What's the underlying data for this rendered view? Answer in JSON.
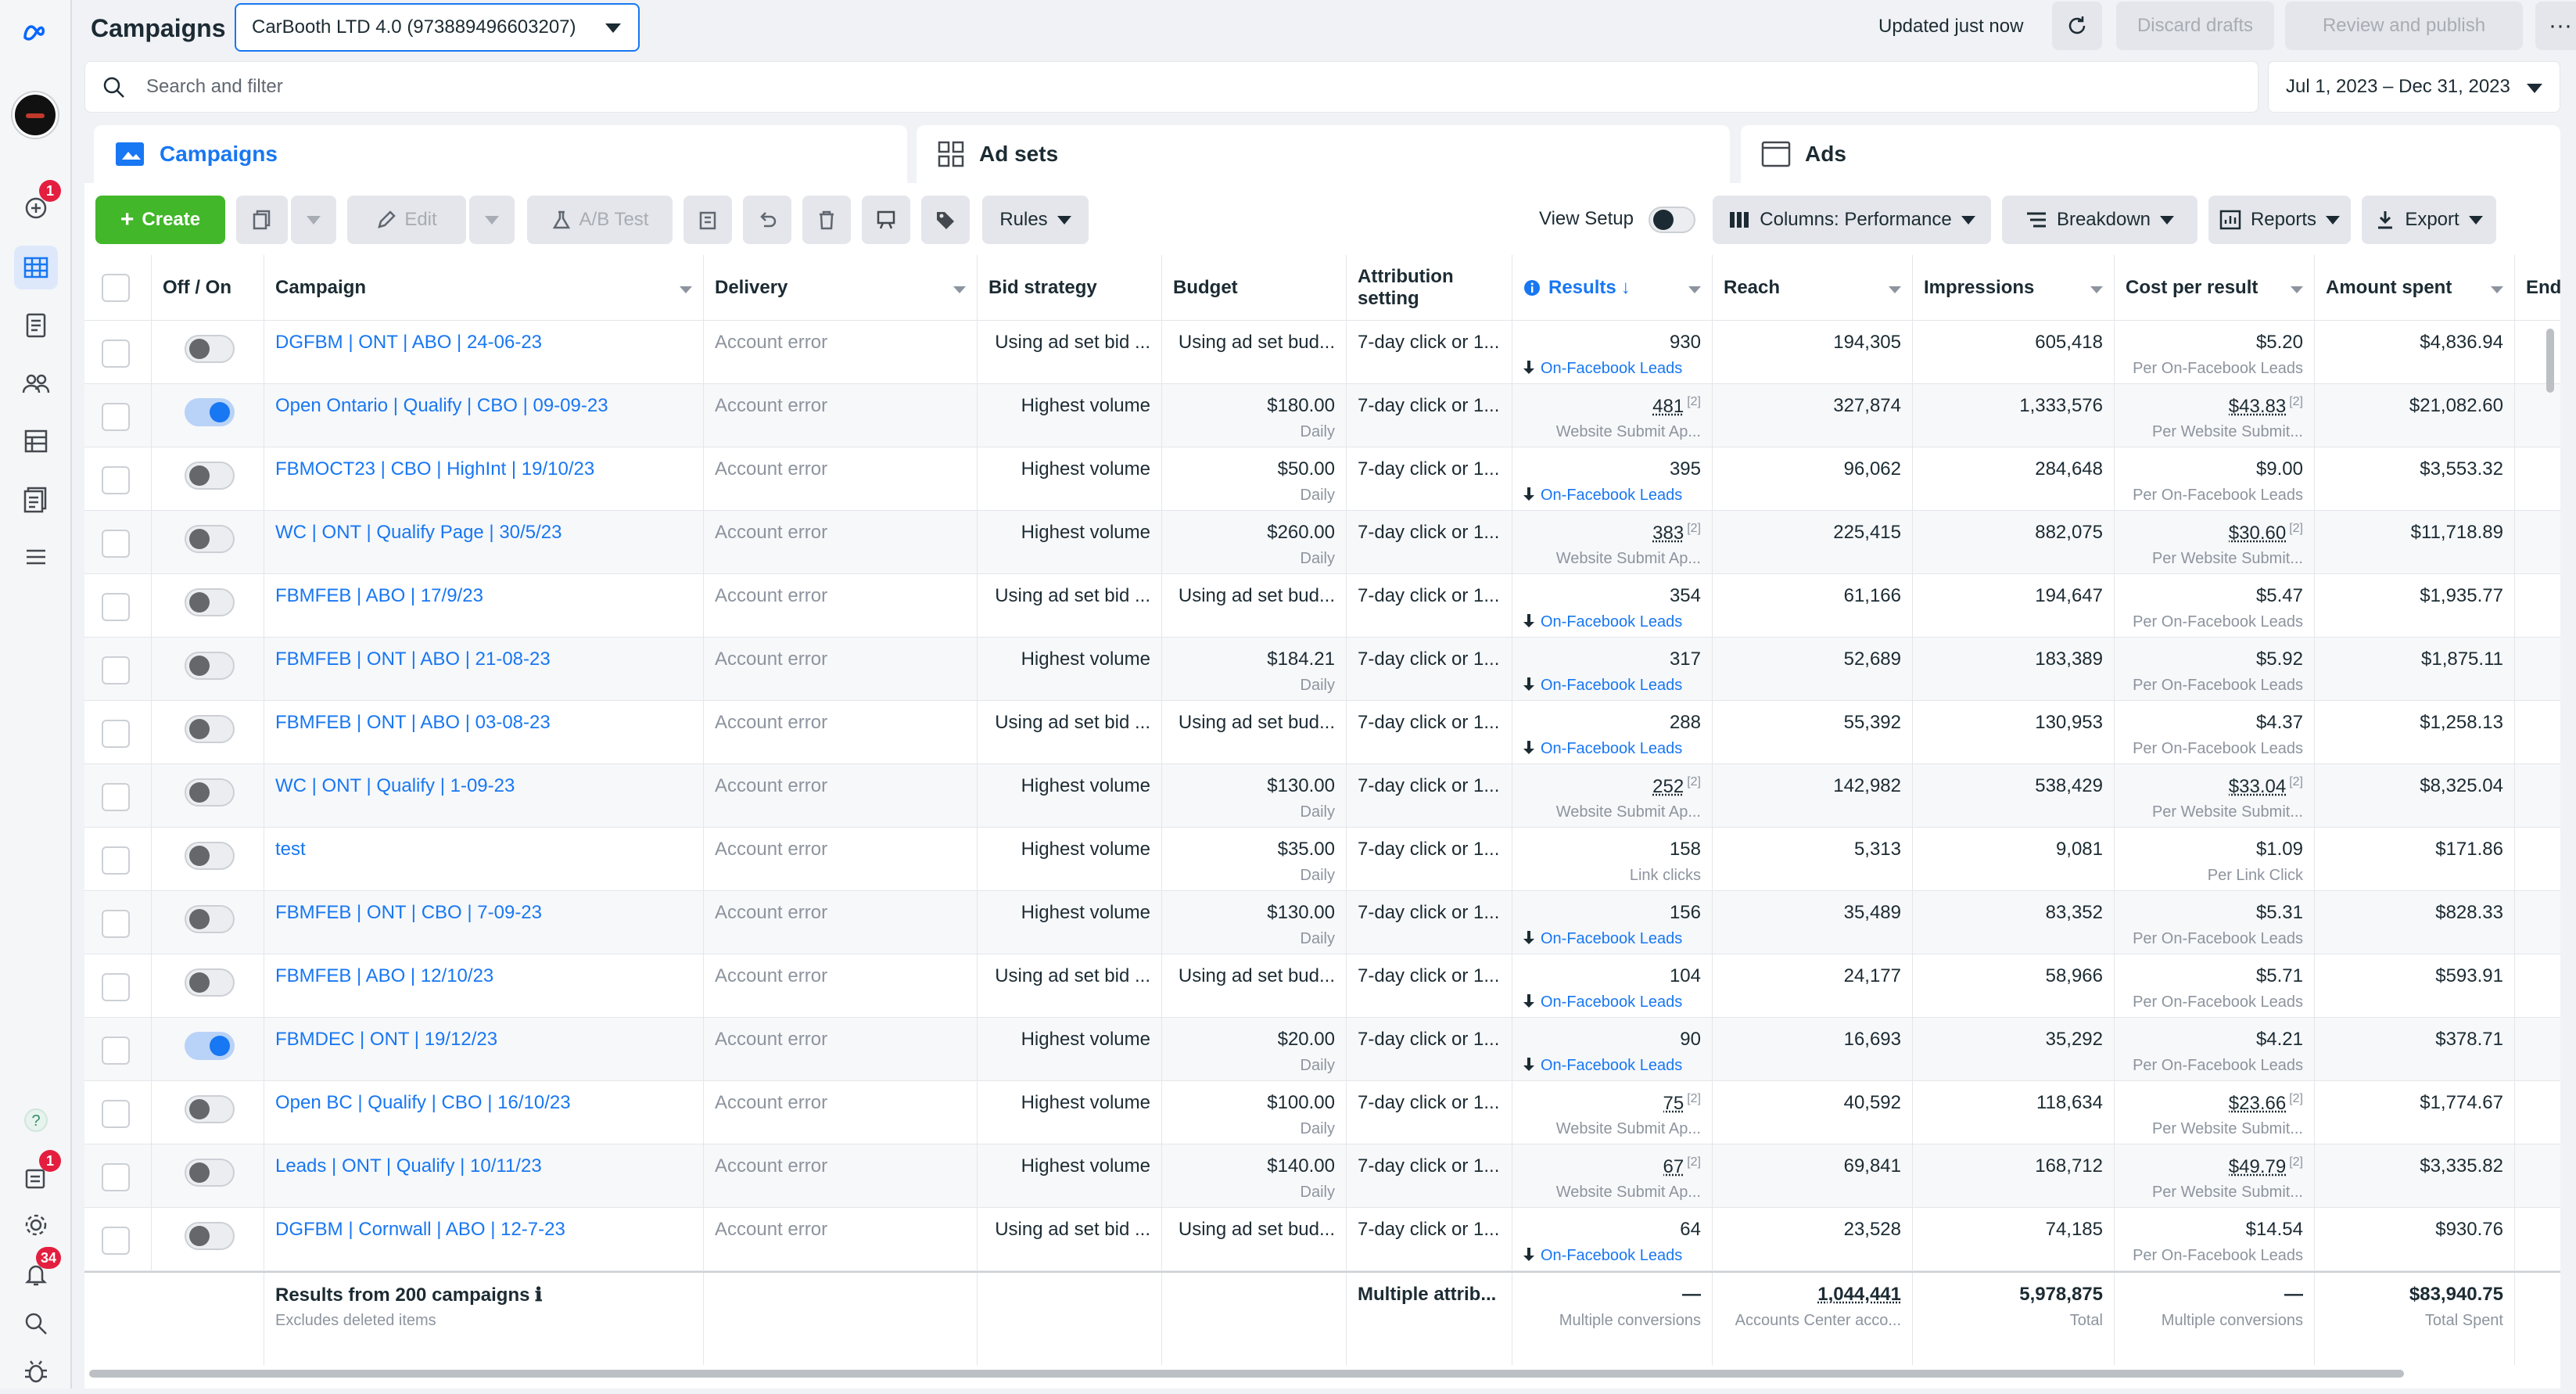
{
  "header": {
    "title": "Campaigns",
    "account": "CarBooth LTD 4.0 (973889496603207)",
    "updated": "Updated just now",
    "discard_label": "Discard drafts",
    "review_label": "Review and publish",
    "more_label": "···"
  },
  "rail": {
    "badges": {
      "notifications_top": "1",
      "updates": "1",
      "alerts": "34"
    }
  },
  "search": {
    "placeholder": "Search and filter"
  },
  "date_range": "Jul 1, 2023 – Dec 31, 2023",
  "tabs": [
    {
      "label": "Campaigns"
    },
    {
      "label": "Ad sets"
    },
    {
      "label": "Ads"
    }
  ],
  "toolbar": {
    "create": "Create",
    "edit": "Edit",
    "ab_test": "A/B Test",
    "rules": "Rules",
    "view_setup": "View Setup",
    "columns": "Columns: Performance",
    "breakdown": "Breakdown",
    "reports": "Reports",
    "export": "Export"
  },
  "columns": {
    "off_on": "Off / On",
    "campaign": "Campaign",
    "delivery": "Delivery",
    "bid_strategy": "Bid strategy",
    "budget": "Budget",
    "attribution": "Attribution setting",
    "results": "Results",
    "reach": "Reach",
    "impressions": "Impressions",
    "cost_per_result": "Cost per result",
    "amount_spent": "Amount spent",
    "ends": "End"
  },
  "rows": [
    {
      "on": false,
      "name": "DGFBM | ONT | ABO | 24-06-23",
      "delivery": "Account error",
      "bid": "Using ad set bid ...",
      "budget": "Using ad set bud...",
      "budget_sub": "",
      "attr": "7-day click or 1...",
      "results": "930",
      "results_sub": "On-Facebook Leads",
      "results_type": "lead",
      "reach": "194,305",
      "impr": "605,418",
      "cpr": "$5.20",
      "cpr_sub": "Per On-Facebook Leads",
      "spent": "$4,836.94"
    },
    {
      "on": true,
      "name": "Open Ontario | Qualify | CBO | 09-09-23",
      "delivery": "Account error",
      "bid": "Highest volume",
      "budget": "$180.00",
      "budget_sub": "Daily",
      "attr": "7-day click or 1...",
      "results": "481",
      "results_sub": "Website Submit Ap...",
      "results_type": "web",
      "reach": "327,874",
      "impr": "1,333,576",
      "cpr": "$43.83",
      "cpr_sub": "Per Website Submit...",
      "spent": "$21,082.60"
    },
    {
      "on": false,
      "name": "FBMOCT23 | CBO | HighInt | 19/10/23",
      "delivery": "Account error",
      "bid": "Highest volume",
      "budget": "$50.00",
      "budget_sub": "Daily",
      "attr": "7-day click or 1...",
      "results": "395",
      "results_sub": "On-Facebook Leads",
      "results_type": "lead",
      "reach": "96,062",
      "impr": "284,648",
      "cpr": "$9.00",
      "cpr_sub": "Per On-Facebook Leads",
      "spent": "$3,553.32"
    },
    {
      "on": false,
      "name": "WC | ONT | Qualify Page | 30/5/23",
      "delivery": "Account error",
      "bid": "Highest volume",
      "budget": "$260.00",
      "budget_sub": "Daily",
      "attr": "7-day click or 1...",
      "results": "383",
      "results_sub": "Website Submit Ap...",
      "results_type": "web",
      "reach": "225,415",
      "impr": "882,075",
      "cpr": "$30.60",
      "cpr_sub": "Per Website Submit...",
      "spent": "$11,718.89"
    },
    {
      "on": false,
      "name": "FBMFEB | ABO | 17/9/23",
      "delivery": "Account error",
      "bid": "Using ad set bid ...",
      "budget": "Using ad set bud...",
      "budget_sub": "",
      "attr": "7-day click or 1...",
      "results": "354",
      "results_sub": "On-Facebook Leads",
      "results_type": "lead",
      "reach": "61,166",
      "impr": "194,647",
      "cpr": "$5.47",
      "cpr_sub": "Per On-Facebook Leads",
      "spent": "$1,935.77"
    },
    {
      "on": false,
      "name": "FBMFEB | ONT | ABO | 21-08-23",
      "delivery": "Account error",
      "bid": "Highest volume",
      "budget": "$184.21",
      "budget_sub": "Daily",
      "attr": "7-day click or 1...",
      "results": "317",
      "results_sub": "On-Facebook Leads",
      "results_type": "lead",
      "reach": "52,689",
      "impr": "183,389",
      "cpr": "$5.92",
      "cpr_sub": "Per On-Facebook Leads",
      "spent": "$1,875.11"
    },
    {
      "on": false,
      "name": "FBMFEB | ONT | ABO | 03-08-23",
      "delivery": "Account error",
      "bid": "Using ad set bid ...",
      "budget": "Using ad set bud...",
      "budget_sub": "",
      "attr": "7-day click or 1...",
      "results": "288",
      "results_sub": "On-Facebook Leads",
      "results_type": "lead",
      "reach": "55,392",
      "impr": "130,953",
      "cpr": "$4.37",
      "cpr_sub": "Per On-Facebook Leads",
      "spent": "$1,258.13"
    },
    {
      "on": false,
      "name": "WC | ONT | Qualify | 1-09-23",
      "delivery": "Account error",
      "bid": "Highest volume",
      "budget": "$130.00",
      "budget_sub": "Daily",
      "attr": "7-day click or 1...",
      "results": "252",
      "results_sub": "Website Submit Ap...",
      "results_type": "web",
      "reach": "142,982",
      "impr": "538,429",
      "cpr": "$33.04",
      "cpr_sub": "Per Website Submit...",
      "spent": "$8,325.04"
    },
    {
      "on": false,
      "name": "test",
      "delivery": "Account error",
      "bid": "Highest volume",
      "budget": "$35.00",
      "budget_sub": "Daily",
      "attr": "7-day click or 1...",
      "results": "158",
      "results_sub": "Link clicks",
      "results_type": "plain",
      "reach": "5,313",
      "impr": "9,081",
      "cpr": "$1.09",
      "cpr_sub": "Per Link Click",
      "spent": "$171.86"
    },
    {
      "on": false,
      "name": "FBMFEB | ONT | CBO | 7-09-23",
      "delivery": "Account error",
      "bid": "Highest volume",
      "budget": "$130.00",
      "budget_sub": "Daily",
      "attr": "7-day click or 1...",
      "results": "156",
      "results_sub": "On-Facebook Leads",
      "results_type": "lead",
      "reach": "35,489",
      "impr": "83,352",
      "cpr": "$5.31",
      "cpr_sub": "Per On-Facebook Leads",
      "spent": "$828.33"
    },
    {
      "on": false,
      "name": "FBMFEB | ABO | 12/10/23",
      "delivery": "Account error",
      "bid": "Using ad set bid ...",
      "budget": "Using ad set bud...",
      "budget_sub": "",
      "attr": "7-day click or 1...",
      "results": "104",
      "results_sub": "On-Facebook Leads",
      "results_type": "lead",
      "reach": "24,177",
      "impr": "58,966",
      "cpr": "$5.71",
      "cpr_sub": "Per On-Facebook Leads",
      "spent": "$593.91"
    },
    {
      "on": true,
      "name": "FBMDEC | ONT | 19/12/23",
      "delivery": "Account error",
      "bid": "Highest volume",
      "budget": "$20.00",
      "budget_sub": "Daily",
      "attr": "7-day click or 1...",
      "results": "90",
      "results_sub": "On-Facebook Leads",
      "results_type": "lead",
      "reach": "16,693",
      "impr": "35,292",
      "cpr": "$4.21",
      "cpr_sub": "Per On-Facebook Leads",
      "spent": "$378.71"
    },
    {
      "on": false,
      "name": "Open BC | Qualify | CBO | 16/10/23",
      "delivery": "Account error",
      "bid": "Highest volume",
      "budget": "$100.00",
      "budget_sub": "Daily",
      "attr": "7-day click or 1...",
      "results": "75",
      "results_sub": "Website Submit Ap...",
      "results_type": "web",
      "reach": "40,592",
      "impr": "118,634",
      "cpr": "$23.66",
      "cpr_sub": "Per Website Submit...",
      "spent": "$1,774.67"
    },
    {
      "on": false,
      "name": "Leads | ONT | Qualify | 10/11/23",
      "delivery": "Account error",
      "bid": "Highest volume",
      "budget": "$140.00",
      "budget_sub": "Daily",
      "attr": "7-day click or 1...",
      "results": "67",
      "results_sub": "Website Submit Ap...",
      "results_type": "web",
      "reach": "69,841",
      "impr": "168,712",
      "cpr": "$49.79",
      "cpr_sub": "Per Website Submit...",
      "spent": "$3,335.82"
    },
    {
      "on": false,
      "name": "DGFBM | Cornwall | ABO | 12-7-23",
      "delivery": "Account error",
      "bid": "Using ad set bid ...",
      "budget": "Using ad set bud...",
      "budget_sub": "",
      "attr": "7-day click or 1...",
      "results": "64",
      "results_sub": "On-Facebook Leads",
      "results_type": "lead",
      "reach": "23,528",
      "impr": "74,185",
      "cpr": "$14.54",
      "cpr_sub": "Per On-Facebook Leads",
      "spent": "$930.76"
    }
  ],
  "footer": {
    "label": "Results from 200 campaigns",
    "sub": "Excludes deleted items",
    "attr": "Multiple attrib...",
    "results": "—",
    "results_sub": "Multiple conversions",
    "reach": "1,044,441",
    "reach_sub": "Accounts Center acco...",
    "impr": "5,978,875",
    "impr_sub": "Total",
    "cpr": "—",
    "cpr_sub": "Multiple conversions",
    "spent": "$83,940.75",
    "spent_sub": "Total Spent"
  },
  "superscript": "[2]",
  "colors": {
    "accent": "#1877f2",
    "create": "#42b72a",
    "badge": "#e41e3f"
  }
}
